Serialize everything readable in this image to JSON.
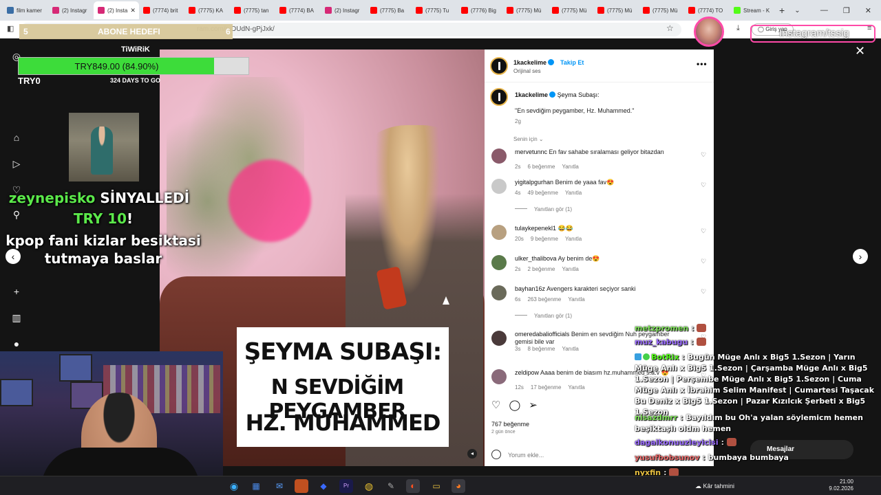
{
  "browser": {
    "tabs": [
      {
        "label": "film kamer",
        "color": "#3a6ea5"
      },
      {
        "label": "(2) Instagr",
        "color": "#d62976"
      },
      {
        "label": "(2) Insta",
        "color": "#d62976",
        "active": true
      },
      {
        "label": "(7774) brit",
        "color": "#ff0000"
      },
      {
        "label": "(7775) KA",
        "color": "#ff0000"
      },
      {
        "label": "(7775) tan",
        "color": "#ff0000"
      },
      {
        "label": "(7774) BA",
        "color": "#ff0000"
      },
      {
        "label": "(2) Instagr",
        "color": "#d62976"
      },
      {
        "label": "(7775) Ba",
        "color": "#ff0000"
      },
      {
        "label": "(7775) Tu",
        "color": "#ff0000"
      },
      {
        "label": "(7776) Big",
        "color": "#ff0000"
      },
      {
        "label": "(7775) Mü",
        "color": "#ff0000"
      },
      {
        "label": "(7775) Mü",
        "color": "#ff0000"
      },
      {
        "label": "(7775) Mü",
        "color": "#ff0000"
      },
      {
        "label": "(7775) Mü",
        "color": "#ff0000"
      },
      {
        "label": "(7774) TO",
        "color": "#ff0000"
      },
      {
        "label": "Stream - K",
        "color": "#53fc18"
      }
    ],
    "url": "ram.com/p/DUdN-gPjJxk/",
    "login_label": "Giriş yap"
  },
  "goal": {
    "top_left": "5",
    "top_title": "ABONE HEDEFI",
    "top_right": "6",
    "title": "TiWiRiK",
    "amount": "TRY849.00 (84.90%)",
    "progress_pct": 84.9,
    "left_label": "TRY0",
    "days": "324 DAYS TO GO"
  },
  "alert": {
    "name": "zeynepisko",
    "action": "SİNYALLEDİ",
    "amount": "TRY 10",
    "bang": "!",
    "line1": "kpop fani kizlar besiktasi",
    "line2": "tutmaya baslar"
  },
  "video": {
    "caption_line1": "ŞEYMA SUBAŞI:",
    "caption_line2": "N SEVDİĞİM PEYGAMBER",
    "caption_line3": "HZ. MUHAMMED"
  },
  "post": {
    "author": "1kackelime",
    "follow": "Takip Et",
    "audio": "Orijinal ses",
    "more": "•••",
    "caption_prefix": "Şeyma Subaşı:",
    "caption_quote": "\"En sevdiğim peygamber, Hz. Muhammed.\"",
    "caption_age": "2g",
    "sort_label": "Senin için",
    "likes": "767 beğenme",
    "date": "2 gün önce",
    "comment_placeholder": "Yorum ekle..."
  },
  "comments": [
    {
      "user": "mervetunnc",
      "text": "En fav sahabe sıralaması geliyor bitazdan",
      "age": "2s",
      "likes": "6 beğenme",
      "reply": "Yanıtla",
      "avatar": "#8a5a6a"
    },
    {
      "user": "yigitalpgurhan",
      "text": "Benim de yaaa fav😍",
      "age": "4s",
      "likes": "49 beğenme",
      "reply": "Yanıtla",
      "avatar": "#c9c9c9"
    },
    {
      "user": "tulaykepenekl1",
      "text": "😂😂",
      "age": "20s",
      "likes": "9 beğenme",
      "reply": "Yanıtla",
      "avatar": "#b8a080"
    },
    {
      "user": "ulker_thalibova",
      "text": "Ay benim de😍",
      "age": "2s",
      "likes": "2 beğenme",
      "reply": "Yanıtla",
      "avatar": "#5a7a4a"
    },
    {
      "user": "bayhan16z",
      "text": "Avengers karakteri seçiyor sanki",
      "age": "6s",
      "likes": "263 beğenme",
      "reply": "Yanıtla",
      "avatar": "#6a6a5a"
    },
    {
      "user": "omeredabaliofficials",
      "text": "Benim en sevdiğim Nuh peygamber gemisi bile var",
      "age": "3s",
      "likes": "8 beğenme",
      "reply": "Yanıtla",
      "avatar": "#4a3a3a"
    },
    {
      "user": "zeldipow",
      "text": "Aaaa benim de biasım hz.muhammed s.a.v 😍",
      "age": "12s",
      "likes": "17 beğenme",
      "reply": "Yanıtla",
      "avatar": "#8a6a7a"
    }
  ],
  "replies_label": "Yanıtları gör (1)",
  "chat": [
    {
      "name": "metzpromen",
      "sep": ":",
      "text": "",
      "color": "#7ee05a"
    },
    {
      "name": "muz_kabugu",
      "sep": ":",
      "text": "",
      "color": "#9b6cff"
    },
    {
      "name": "BotRix",
      "sep": ":",
      "text": "Bugün Müge Anlı x Big5 1.Sezon | Yarın Müge Anlı x Big5 1.Sezon | Çarşamba Müge Anlı x Big5 1.Sezon | Perşembe Müge Anlı x Big5 1.Sezon | Cuma Müge Anlı x İbrahim Selim Manifest | Cumartesi Taşacak Bu Deniz x Big5 1.Sezon | Pazar Kızılcık Şerbeti x Big5 1.Sezon",
      "color": "#53fc18"
    },
    {
      "name": "nisazdmrr",
      "sep": ":",
      "text": "Bayıldım bu Oh'a yalan söylemicm hemen beşiktaşlı oldm hemen",
      "color": "#7ee05a"
    },
    {
      "name": "dagalkonuuzleyicisi",
      "sep": ":",
      "text": "",
      "color": "#9b6cff"
    },
    {
      "name": "yusufbobsunov",
      "sep": ":",
      "text": "bumbaya bumbaya",
      "color": "#e86a6a"
    },
    {
      "name": "nyxfin",
      "sep": ":",
      "text": "",
      "color": "#e8c040"
    }
  ],
  "overlay_handle": "Instagram/tssig",
  "messages_label": "Mesajlar",
  "taskbar": {
    "weather": "Kâr tahmini",
    "time": "21:00",
    "date": "9.02.2026"
  },
  "colors": {
    "goal_fill": "#3ddc3a",
    "ig_blue": "#0095f6",
    "alert_green": "#5be84a",
    "kick_green": "#53fc18"
  }
}
